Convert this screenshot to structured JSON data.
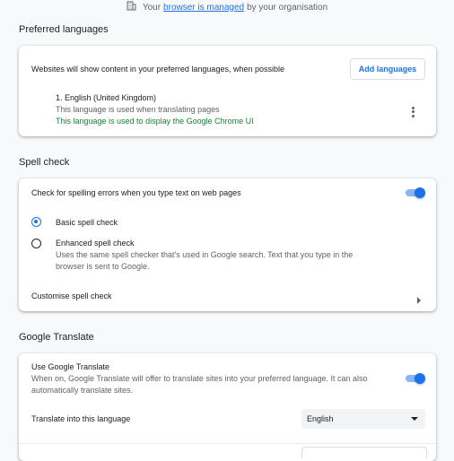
{
  "banner": {
    "prefix": "Your",
    "link": "browser is managed",
    "suffix": "by your organisation"
  },
  "preferred_languages": {
    "title": "Preferred languages",
    "description": "Websites will show content in your preferred languages, when possible",
    "add_button": "Add languages",
    "languages": [
      {
        "name": "1. English (United Kingdom)",
        "translate_note": "This language is used when translating pages",
        "ui_note": "This language is used to display the Google Chrome UI"
      }
    ]
  },
  "spell_check": {
    "title": "Spell check",
    "toggle_label": "Check for spelling errors when you type text on web pages",
    "toggle_on": true,
    "options": [
      {
        "label": "Basic spell check",
        "selected": true
      },
      {
        "label": "Enhanced spell check",
        "selected": false,
        "description": "Uses the same spell checker that's used in Google search. Text that you type in the browser is sent to Google."
      }
    ],
    "customise_label": "Customise spell check"
  },
  "google_translate": {
    "title": "Google Translate",
    "use_label": "Use Google Translate",
    "use_description": "When on, Google Translate will offer to translate sites into your preferred language. It can also automatically translate sites.",
    "toggle_on": true,
    "translate_into_label": "Translate into this language",
    "translate_into_value": "English"
  },
  "colors": {
    "accent": "#1a73e8",
    "accent_light": "#8ab4f8",
    "green": "#188038",
    "background": "#f8f9fa"
  }
}
